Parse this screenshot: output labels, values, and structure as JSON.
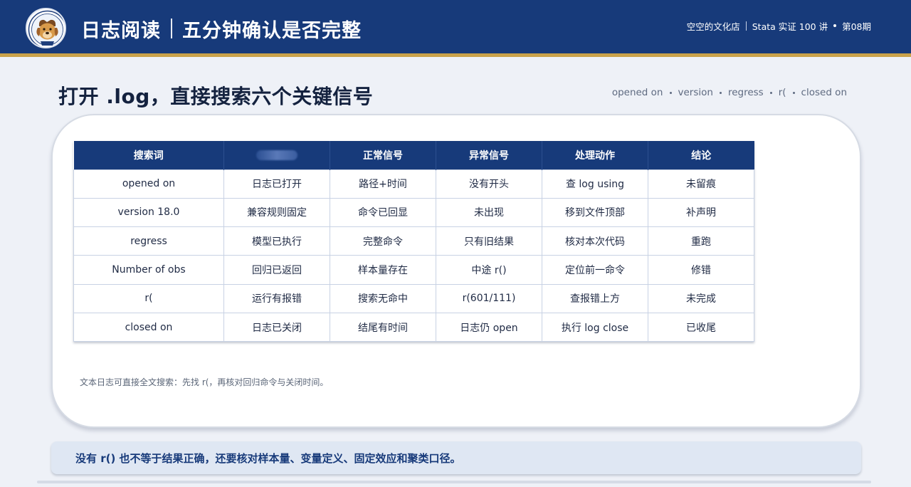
{
  "header": {
    "title_left": "日志阅读",
    "title_right": "五分钟确认是否完整",
    "meta_shop": "空空的文化店",
    "meta_course": "Stata 实证 100 讲",
    "meta_issue": "第08期",
    "logo_text": "空空的文化店",
    "accent_color": "#173a7a",
    "gold_color": "#c9a24a"
  },
  "page": {
    "title": "打开 .log，直接搜索六个关键信号",
    "keywords": [
      "opened on",
      "version",
      "regress",
      "r(",
      "closed on"
    ]
  },
  "table": {
    "headers": [
      "搜索词",
      "",
      "正常信号",
      "异常信号",
      "处理动作",
      "结论"
    ],
    "rows": [
      [
        "opened on",
        "日志已打开",
        "路径+时间",
        "没有开头",
        "查 log using",
        "未留痕"
      ],
      [
        "version 18.0",
        "兼容规则固定",
        "命令已回显",
        "未出现",
        "移到文件顶部",
        "补声明"
      ],
      [
        "regress",
        "模型已执行",
        "完整命令",
        "只有旧结果",
        "核对本次代码",
        "重跑"
      ],
      [
        "Number of obs",
        "回归已返回",
        "样本量存在",
        "中途 r()",
        "定位前一命令",
        "修错"
      ],
      [
        "r(",
        "运行有报错",
        "搜索无命中",
        "r(601/111)",
        "查报错上方",
        "未完成"
      ],
      [
        "closed on",
        "日志已关闭",
        "结尾有时间",
        "日志仍 open",
        "执行 log close",
        "已收尾"
      ]
    ]
  },
  "note": "文本日志可直接全文搜索：先找 r(，再核对回归命令与关闭时间。",
  "footer": "没有 r() 也不等于结果正确，还要核对样本量、变量定义、固定效应和聚类口径。"
}
